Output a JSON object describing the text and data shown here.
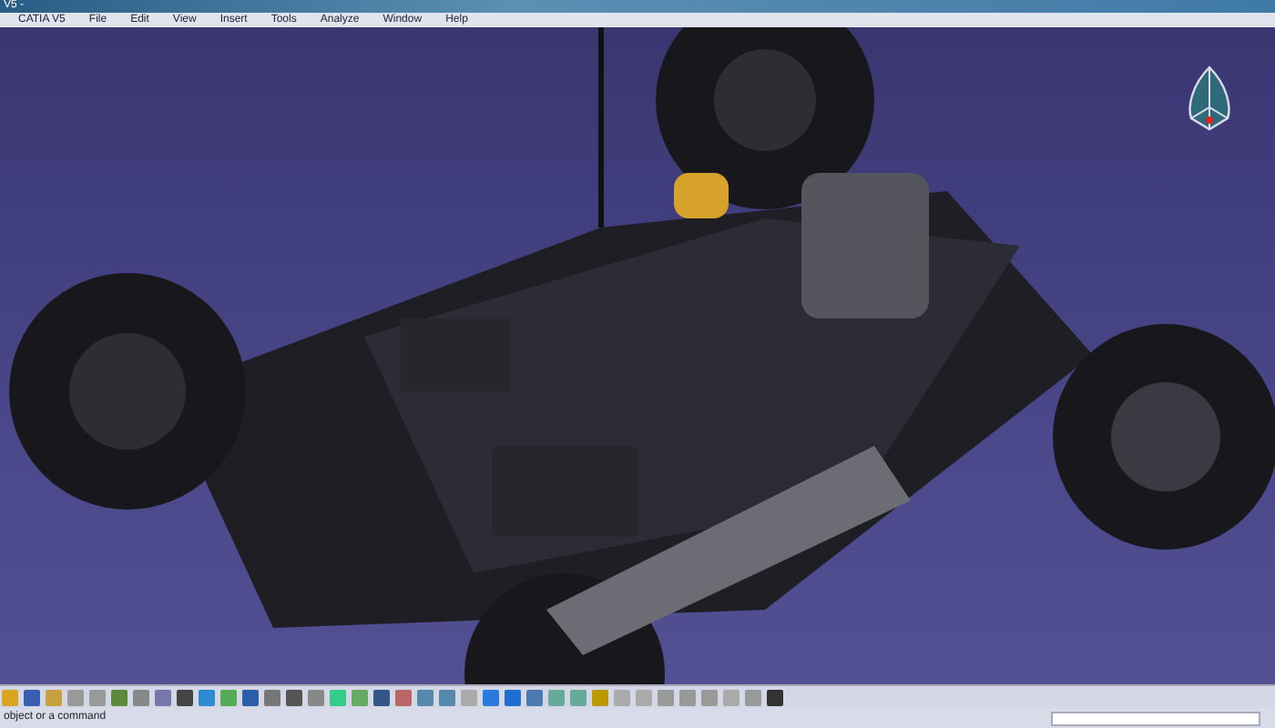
{
  "window": {
    "title": "V5 - "
  },
  "menu": [
    "CATIA V5",
    "File",
    "Edit",
    "View",
    "Insert",
    "Tools",
    "Analyze",
    "Window",
    "Help"
  ],
  "status_bar": {
    "message": "object or a command"
  }
}
